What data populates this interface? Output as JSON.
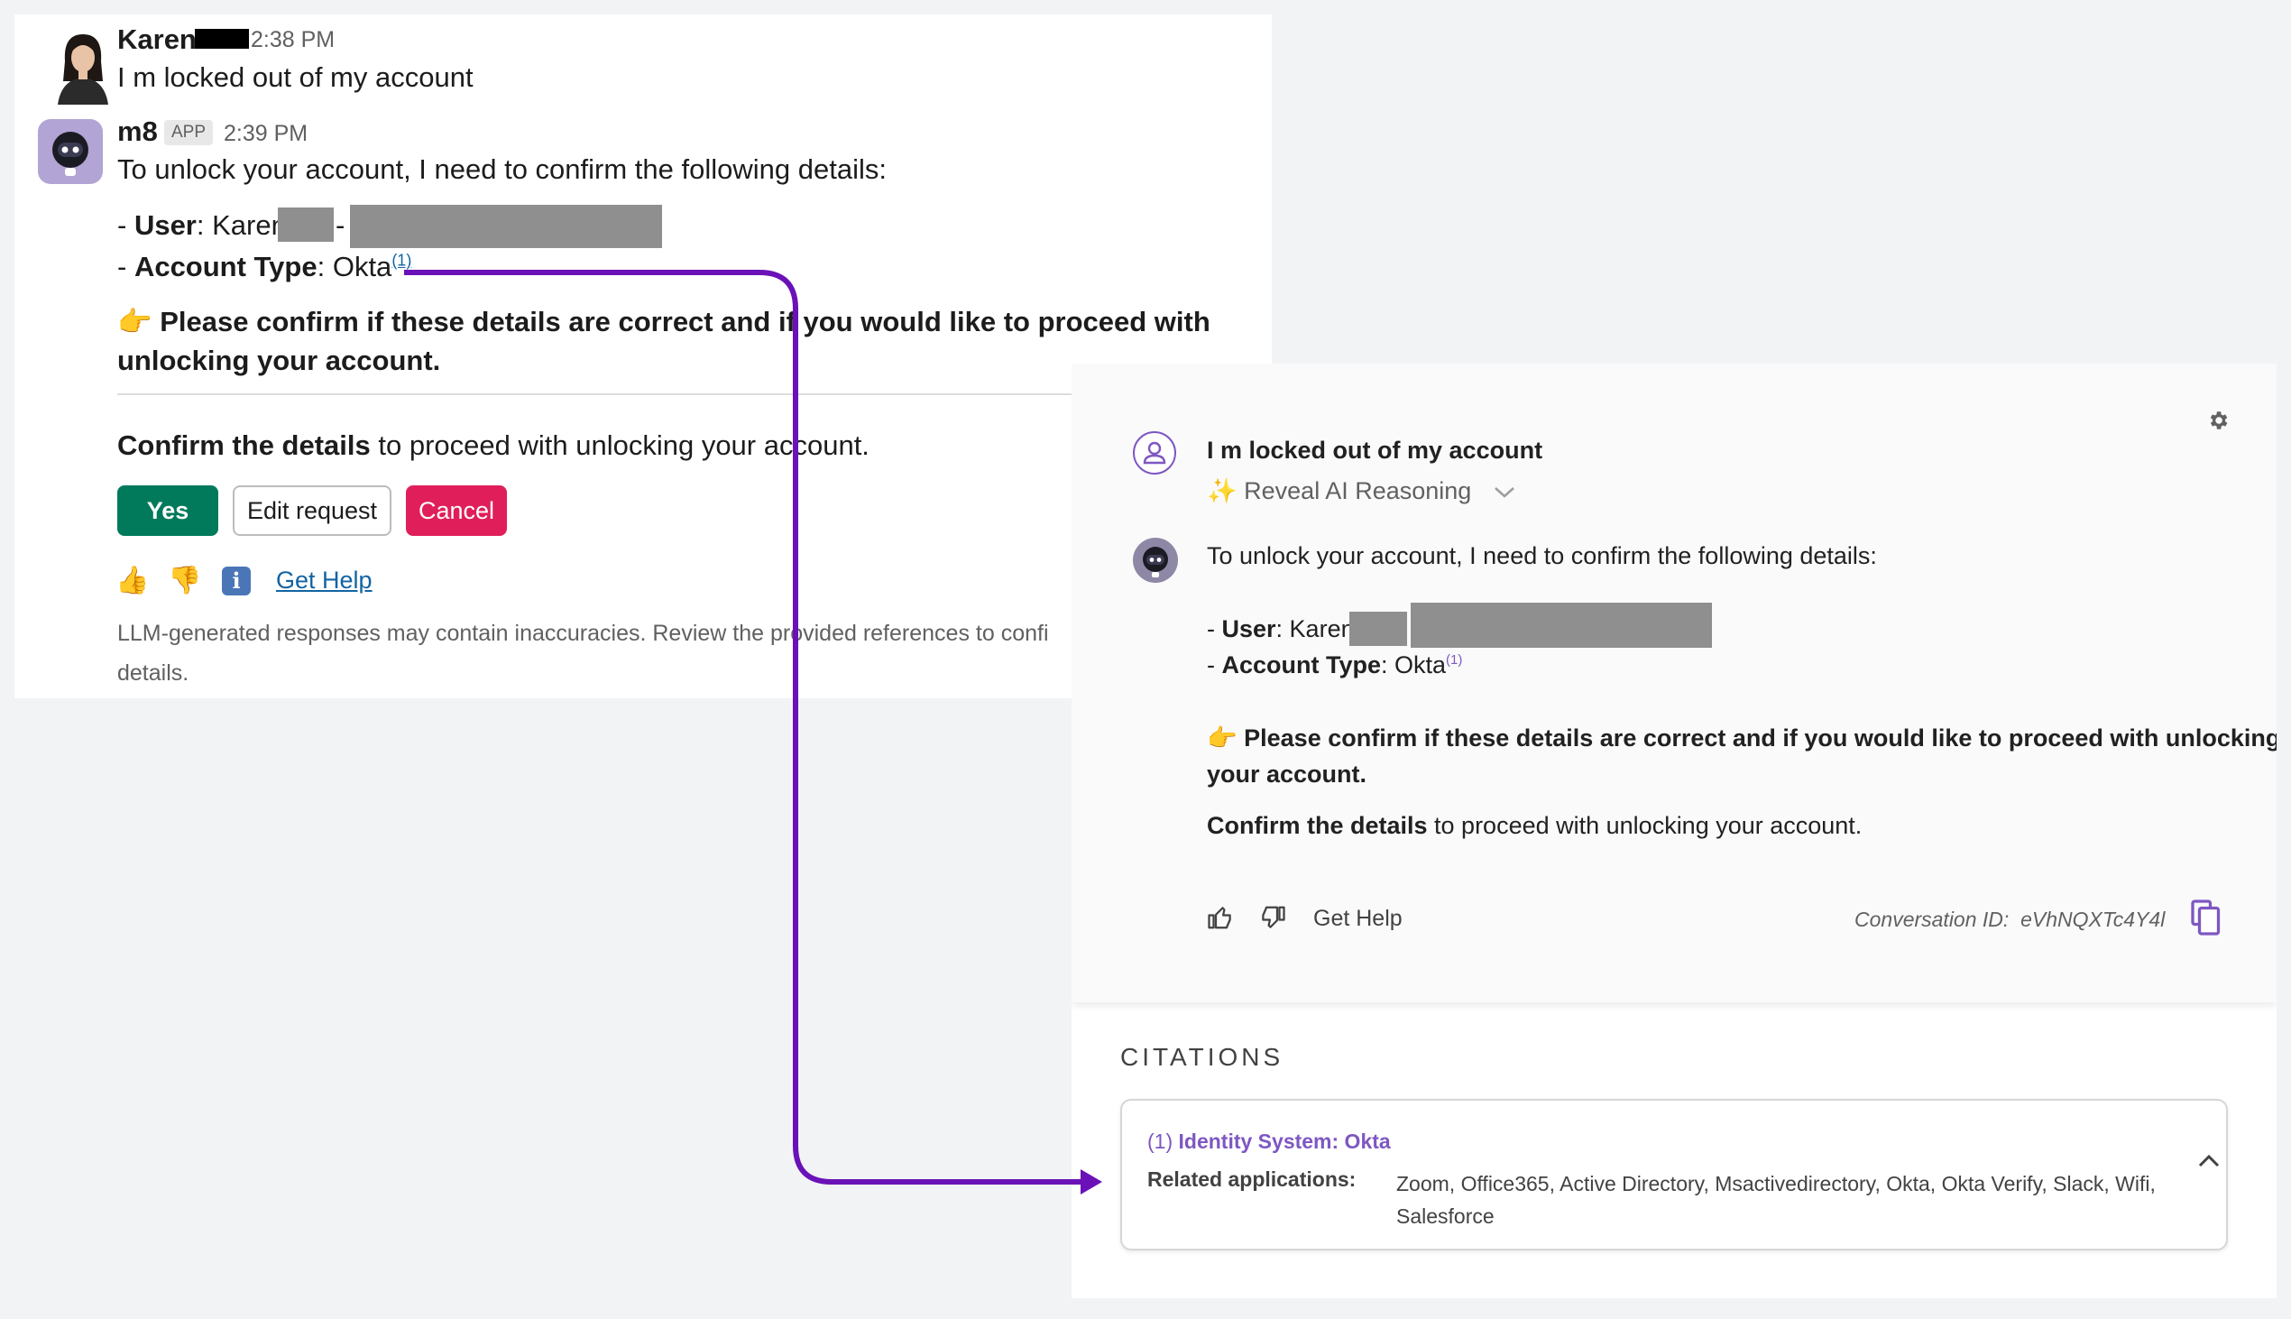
{
  "slack": {
    "msg1": {
      "author": "Karen",
      "time": "2:38 PM",
      "text": "I m locked out of my account"
    },
    "msg2": {
      "author": "m8",
      "badge": "APP",
      "time": "2:39 PM",
      "intro": "To unlock your account, I need to confirm the following details:",
      "user_label": "User",
      "user_prefix": "- ",
      "user_value": ": Karen",
      "account_label": "Account Type",
      "account_prefix": "- ",
      "account_value": ": Okta",
      "citation_ref": "(1)",
      "pointing_emoji": "👉",
      "confirm_line1": "Please confirm if these details are correct and if you would like to proceed with",
      "confirm_line2": "unlocking your account.",
      "confirm_details_bold": "Confirm the details",
      "confirm_details_rest": " to proceed with unlocking your account."
    },
    "buttons": {
      "yes": "Yes",
      "edit": "Edit request",
      "cancel": "Cancel"
    },
    "feedback": {
      "thumbs_up": "👍",
      "thumbs_down": "👎",
      "get_help": "Get Help"
    },
    "disclaimer_line1": "LLM-generated responses may contain inaccuracies. Review the provided references to confi",
    "disclaimer_line2": "details."
  },
  "m8": {
    "user_message": "I m locked out of my account",
    "reveal_sparkle": "✨",
    "reveal_label": "Reveal AI Reasoning",
    "intro": "To unlock your account, I need to confirm the following details:",
    "user_prefix": "- ",
    "user_label": "User",
    "user_value": ": Karen",
    "account_prefix": "- ",
    "account_label": "Account Type",
    "account_value": ": Okta",
    "citation_ref": "(1)",
    "pointing_emoji": "👉",
    "confirm_line1": "Please confirm if these details are correct and if you would like to proceed with unlocking",
    "confirm_line2": "your account.",
    "confirm_details_bold": "Confirm the details",
    "confirm_details_rest": " to proceed with unlocking your account.",
    "get_help": "Get Help",
    "conversation_id_label": "Conversation ID:",
    "conversation_id": "eVhNQXTc4Y4l"
  },
  "citations": {
    "title": "CITATIONS",
    "items": [
      {
        "number": "(1)",
        "name": "Identity System: Okta",
        "label": "Related applications:",
        "apps": "Zoom, Office365, Active Directory, Msactivedirectory, Okta, Okta Verify, Slack, Wifi, Salesforce"
      }
    ]
  },
  "colors": {
    "yes_button": "#007a5a",
    "cancel_button": "#e01e5a",
    "link": "#1264a3",
    "accent_purple": "#7e57c2",
    "connector": "#6a12b8"
  },
  "icons": [
    "thumbs-up-icon",
    "thumbs-down-icon",
    "info-icon",
    "gear-icon",
    "user-icon",
    "bot-icon",
    "copy-icon",
    "chevron-up-icon",
    "chevron-down-icon",
    "arrow-icon"
  ]
}
